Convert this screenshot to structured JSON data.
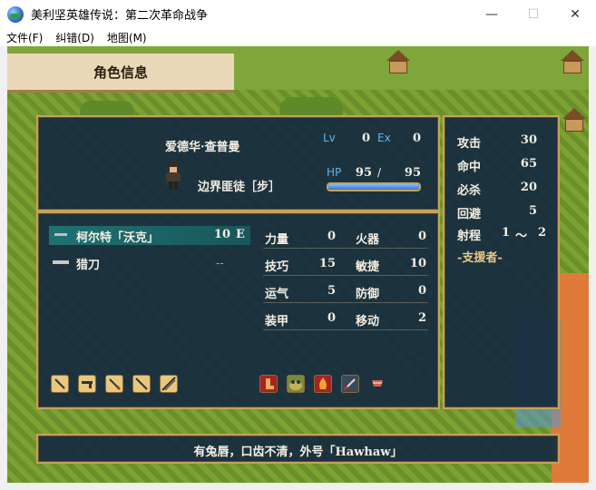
{
  "window": {
    "title": "美利坚英雄传说：第二次革命战争",
    "minimize": "—",
    "maximize": "☐",
    "close": "✕"
  },
  "menu": [
    "文件(F)",
    "纠错(D)",
    "地图(M)"
  ],
  "header": {
    "title": "角色信息"
  },
  "unit": {
    "name": "爱德华·查普曼",
    "class": "边界匪徒［步］",
    "lv_label": "Lv",
    "lv": "0",
    "ex_label": "Ex",
    "ex": "0",
    "hp_label": "HP",
    "hp": "95",
    "hp_sep": "/",
    "hp_max": "95",
    "hp_fraction": 1.0
  },
  "weapons": [
    {
      "name": "柯尔特「沃克」",
      "uses": "10",
      "rank": "E",
      "selected": true
    },
    {
      "name": "猎刀",
      "uses": "--",
      "rank": "",
      "selected": false
    }
  ],
  "stats_left": [
    {
      "label": "力量",
      "value": "0"
    },
    {
      "label": "技巧",
      "value": "15"
    },
    {
      "label": "运气",
      "value": "5"
    },
    {
      "label": "装甲",
      "value": "0"
    }
  ],
  "stats_right": [
    {
      "label": "火器",
      "value": "0"
    },
    {
      "label": "敏捷",
      "value": "10"
    },
    {
      "label": "防御",
      "value": "0"
    },
    {
      "label": "移动",
      "value": "2"
    }
  ],
  "combat": [
    {
      "label": "攻击",
      "value": "30"
    },
    {
      "label": "命中",
      "value": "65"
    },
    {
      "label": "必杀",
      "value": "20"
    },
    {
      "label": "回避",
      "value": "5"
    }
  ],
  "range": {
    "label": "射程",
    "min": "1",
    "sep": "〜",
    "max": "2"
  },
  "support": {
    "label": "-支援者-"
  },
  "weapon_rank_icons": [
    "sword-rank-icon",
    "pistol-rank-icon",
    "knife-rank-icon",
    "rifle-rank-icon",
    "polearm-rank-icon"
  ],
  "skill_icons": [
    "boot-skill-icon",
    "toad-skill-icon",
    "fire-skill-icon",
    "blade-skill-icon",
    "shield-skill-icon"
  ],
  "description": "有兔唇，口齿不清，外号「Hawhaw」"
}
